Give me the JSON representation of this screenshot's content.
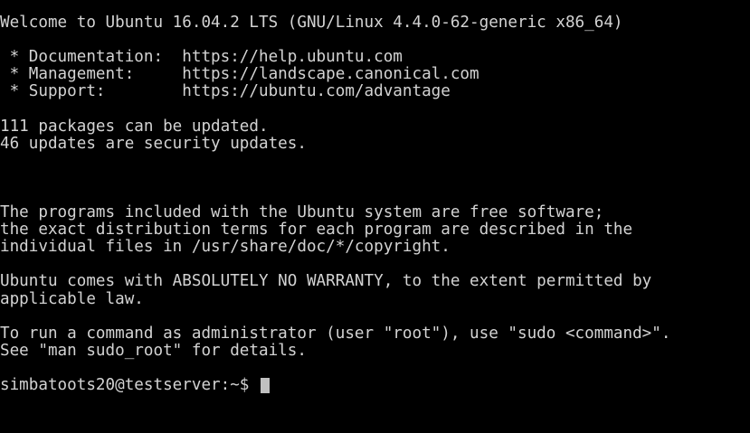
{
  "terminal": {
    "lines": [
      "Welcome to Ubuntu 16.04.2 LTS (GNU/Linux 4.4.0-62-generic x86_64)",
      "",
      " * Documentation:  https://help.ubuntu.com",
      " * Management:     https://landscape.canonical.com",
      " * Support:        https://ubuntu.com/advantage",
      "",
      "111 packages can be updated.",
      "46 updates are security updates.",
      "",
      "",
      "",
      "The programs included with the Ubuntu system are free software;",
      "the exact distribution terms for each program are described in the",
      "individual files in /usr/share/doc/*/copyright.",
      "",
      "Ubuntu comes with ABSOLUTELY NO WARRANTY, to the extent permitted by",
      "applicable law.",
      "",
      "To run a command as administrator (user \"root\"), use \"sudo <command>\".",
      "See \"man sudo_root\" for details.",
      ""
    ],
    "prompt": "simbatoots20@testserver:~$ ",
    "input": "",
    "colors": {
      "background": "#000000",
      "foreground": "#d3d3d3",
      "cursor": "#c0c0c0"
    }
  }
}
